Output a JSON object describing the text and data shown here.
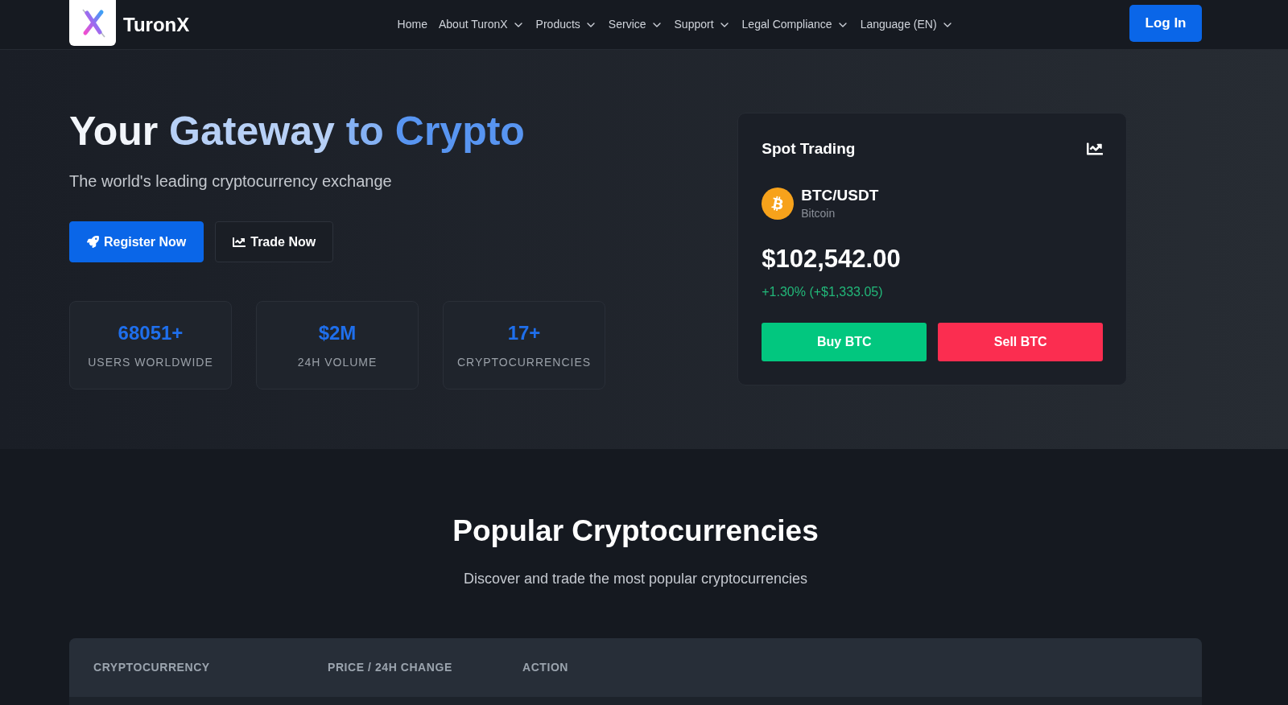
{
  "header": {
    "brand": "TuronX",
    "nav": [
      {
        "label": "Home",
        "dropdown": false
      },
      {
        "label": "About TuronX",
        "dropdown": true
      },
      {
        "label": "Products",
        "dropdown": true
      },
      {
        "label": "Service",
        "dropdown": true
      },
      {
        "label": "Support",
        "dropdown": true
      },
      {
        "label": "Legal Compliance",
        "dropdown": true
      },
      {
        "label": "Language (EN)",
        "dropdown": true
      }
    ],
    "login_button": "Log In"
  },
  "hero": {
    "title": "Your Gateway to Crypto",
    "subtitle": "The world's leading cryptocurrency exchange",
    "buttons": [
      {
        "label": "Register Now",
        "kind": "primary"
      },
      {
        "label": "Trade Now",
        "kind": "outline"
      }
    ],
    "stats": [
      {
        "value": "68051+",
        "label": "USERS WORLDWIDE"
      },
      {
        "value": "$2M",
        "label": "24H VOLUME"
      },
      {
        "value": "17+",
        "label": "CRYPTOCURRENCIES"
      }
    ]
  },
  "trade_card": {
    "title": "Spot Trading",
    "pair": "BTC/USDT",
    "coin": "Bitcoin",
    "price": "$102,542.00",
    "change": "+1.30% (+$1,333.05)",
    "buttons": [
      {
        "label": "Buy BTC",
        "kind": "buy"
      },
      {
        "label": "Sell BTC",
        "kind": "sell"
      }
    ]
  },
  "markets": {
    "title": "Popular Cryptocurrencies",
    "subtitle": "Discover and trade the most popular cryptocurrencies",
    "table": {
      "columns": [
        "CRYPTOCURRENCY",
        "PRICE / 24H CHANGE",
        "ACTION"
      ]
    }
  }
}
